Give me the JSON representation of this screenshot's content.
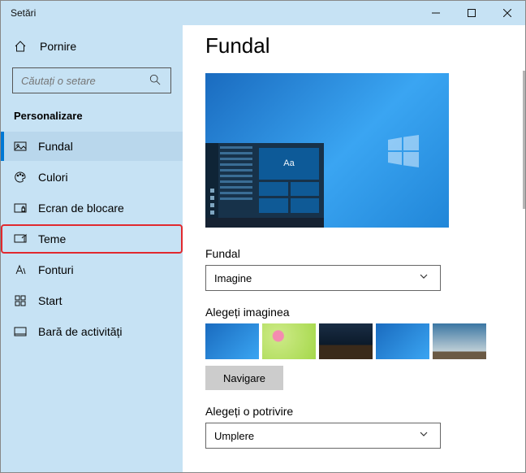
{
  "window": {
    "title": "Setări"
  },
  "sidebar": {
    "home_label": "Pornire",
    "search_placeholder": "Căutați o setare",
    "section": "Personalizare",
    "items": [
      {
        "label": "Fundal"
      },
      {
        "label": "Culori"
      },
      {
        "label": "Ecran de blocare"
      },
      {
        "label": "Teme"
      },
      {
        "label": "Fonturi"
      },
      {
        "label": "Start"
      },
      {
        "label": "Bară de activități"
      }
    ]
  },
  "content": {
    "heading": "Fundal",
    "preview_sample_text": "Aa",
    "background_label": "Fundal",
    "background_value": "Imagine",
    "choose_image_label": "Alegeți imaginea",
    "browse_label": "Navigare",
    "choose_fit_label": "Alegeți o potrivire",
    "fit_value": "Umplere"
  }
}
